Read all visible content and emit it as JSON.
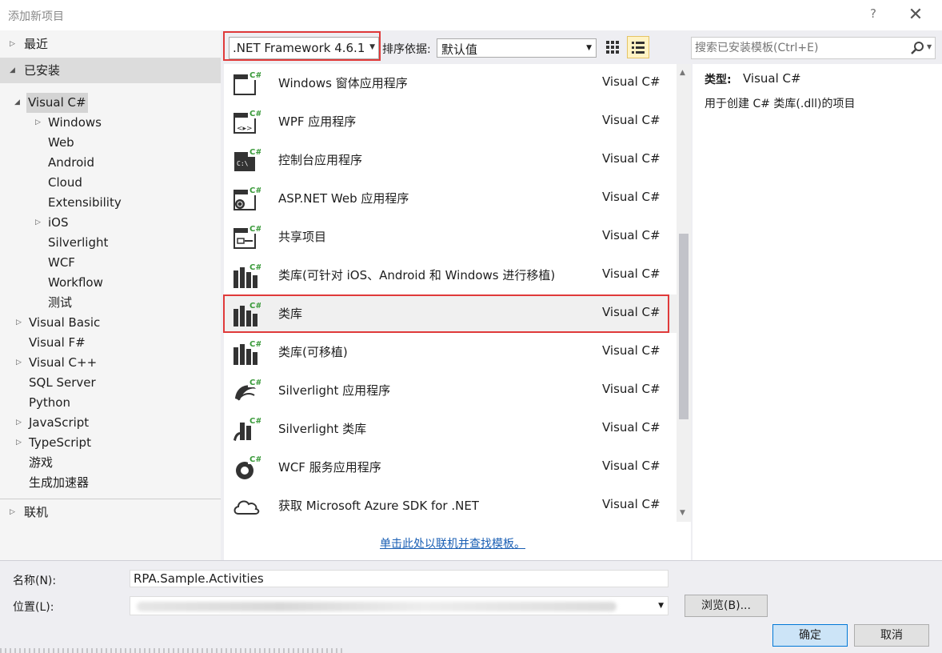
{
  "window": {
    "title": "添加新项目",
    "help_glyph": "?",
    "close_glyph": "✕"
  },
  "tree": {
    "recent": "最近",
    "installed": "已安装",
    "visual_csharp": "Visual C#",
    "csharp_children": [
      "Windows",
      "Web",
      "Android",
      "Cloud",
      "Extensibility",
      "iOS",
      "Silverlight",
      "WCF",
      "Workflow",
      "测试"
    ],
    "languages": [
      "Visual Basic",
      "Visual F#",
      "Visual C++",
      "SQL Server",
      "Python",
      "JavaScript",
      "TypeScript",
      "游戏",
      "生成加速器"
    ],
    "online": "联机"
  },
  "toolbar": {
    "framework": ".NET Framework 4.6.1",
    "sort_label": "排序依据:",
    "sort_value": "默认值"
  },
  "search": {
    "placeholder": "搜索已安装模板(Ctrl+E)"
  },
  "templates": [
    {
      "name": "Windows 窗体应用程序",
      "lang": "Visual C#",
      "icon": "winforms-icon"
    },
    {
      "name": "WPF 应用程序",
      "lang": "Visual C#",
      "icon": "wpf-icon"
    },
    {
      "name": "控制台应用程序",
      "lang": "Visual C#",
      "icon": "console-icon"
    },
    {
      "name": "ASP.NET Web 应用程序",
      "lang": "Visual C#",
      "icon": "web-app-icon"
    },
    {
      "name": "共享项目",
      "lang": "Visual C#",
      "icon": "shared-project-icon"
    },
    {
      "name": "类库(可针对 iOS、Android 和 Windows 进行移植)",
      "lang": "Visual C#",
      "icon": "library-icon"
    },
    {
      "name": "类库",
      "lang": "Visual C#",
      "icon": "library-icon"
    },
    {
      "name": "类库(可移植)",
      "lang": "Visual C#",
      "icon": "library-icon"
    },
    {
      "name": "Silverlight 应用程序",
      "lang": "Visual C#",
      "icon": "silverlight-icon"
    },
    {
      "name": "Silverlight 类库",
      "lang": "Visual C#",
      "icon": "silverlight-library-icon"
    },
    {
      "name": "WCF 服务应用程序",
      "lang": "Visual C#",
      "icon": "wcf-icon"
    },
    {
      "name": "获取 Microsoft Azure SDK for .NET",
      "lang": "Visual C#",
      "icon": "cloud-icon"
    }
  ],
  "online_link": "单击此处以联机并查找模板。",
  "info": {
    "type_label": "类型:",
    "type_value": "Visual C#",
    "description": "用于创建 C# 类库(.dll)的项目"
  },
  "form": {
    "name_label": "名称(N):",
    "name_value": "RPA.Sample.Activities",
    "location_label": "位置(L):",
    "browse_label": "浏览(B)...",
    "ok_label": "确定",
    "cancel_label": "取消"
  },
  "colors": {
    "highlight_red": "#e03a3a",
    "csharp_green": "#3a9a3a",
    "link_blue": "#1a5fb4",
    "primary_button": "#cce4f7"
  }
}
